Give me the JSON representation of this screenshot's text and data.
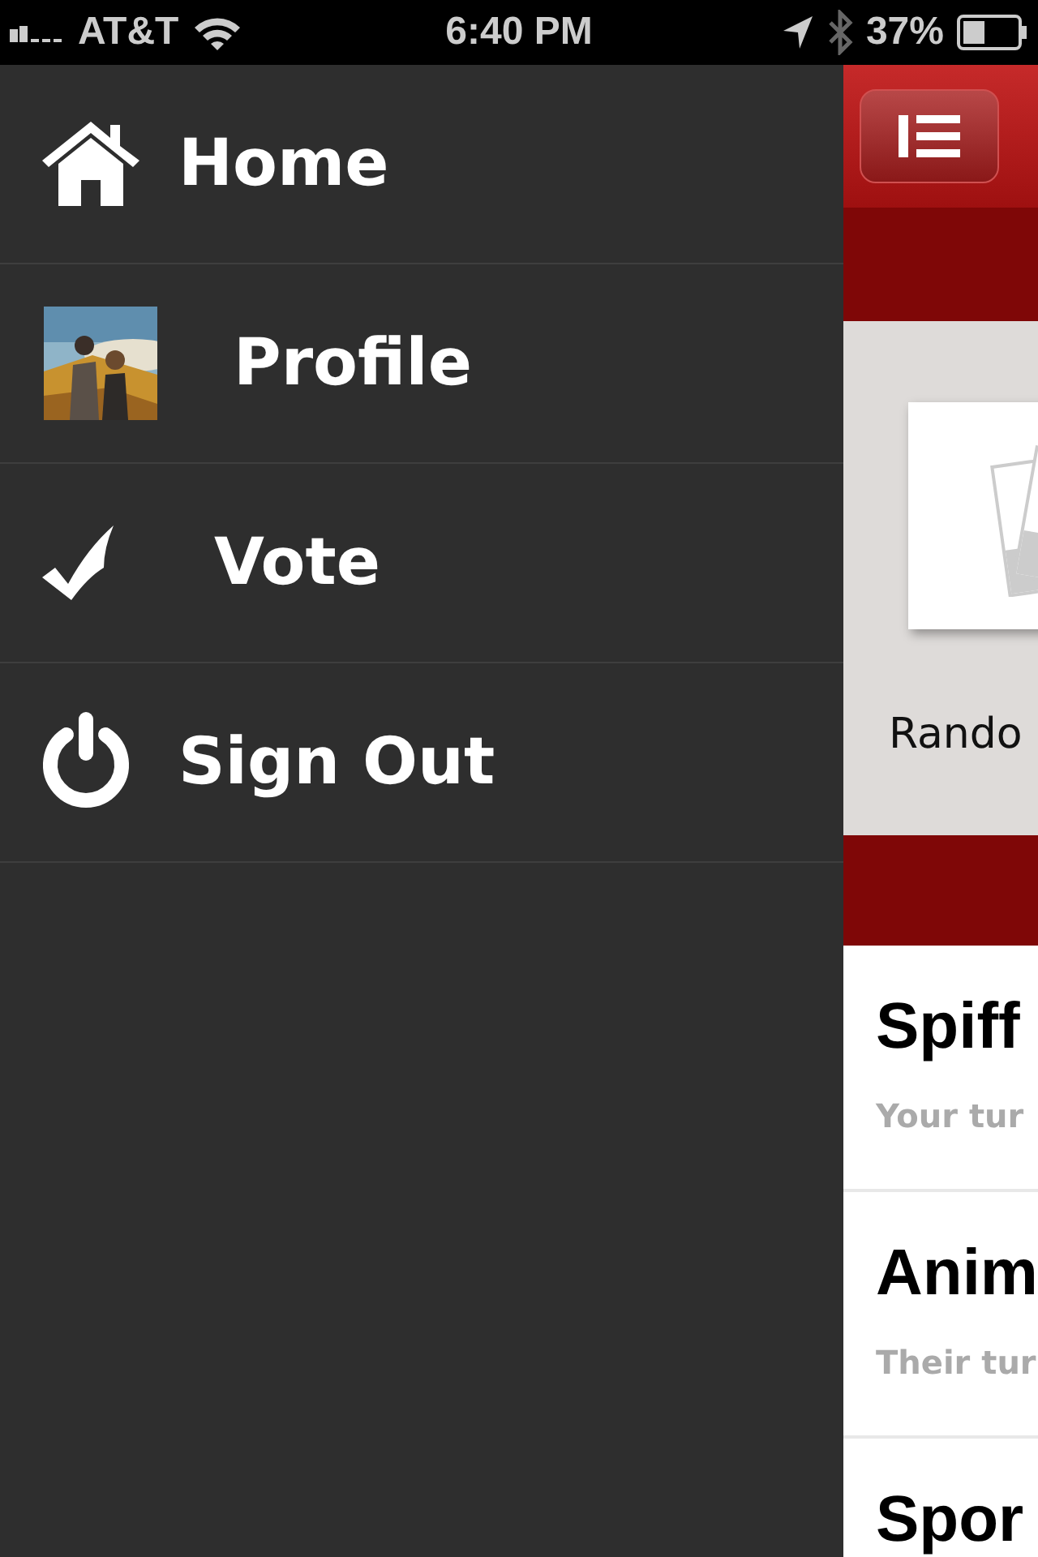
{
  "status_bar": {
    "carrier": "AT&T",
    "time": "6:40 PM",
    "battery": "37%"
  },
  "menu": [
    {
      "kind": "home",
      "label": "Home"
    },
    {
      "kind": "profile",
      "label": "Profile"
    },
    {
      "kind": "vote",
      "label": "Vote"
    },
    {
      "kind": "signout",
      "label": "Sign Out"
    }
  ],
  "main": {
    "featured": {
      "label": "Rando"
    },
    "games": [
      {
        "title": "Spiff",
        "status": "Your tur"
      },
      {
        "title": "Anim",
        "status": "Their tur"
      },
      {
        "title": "Spor"
      }
    ]
  }
}
